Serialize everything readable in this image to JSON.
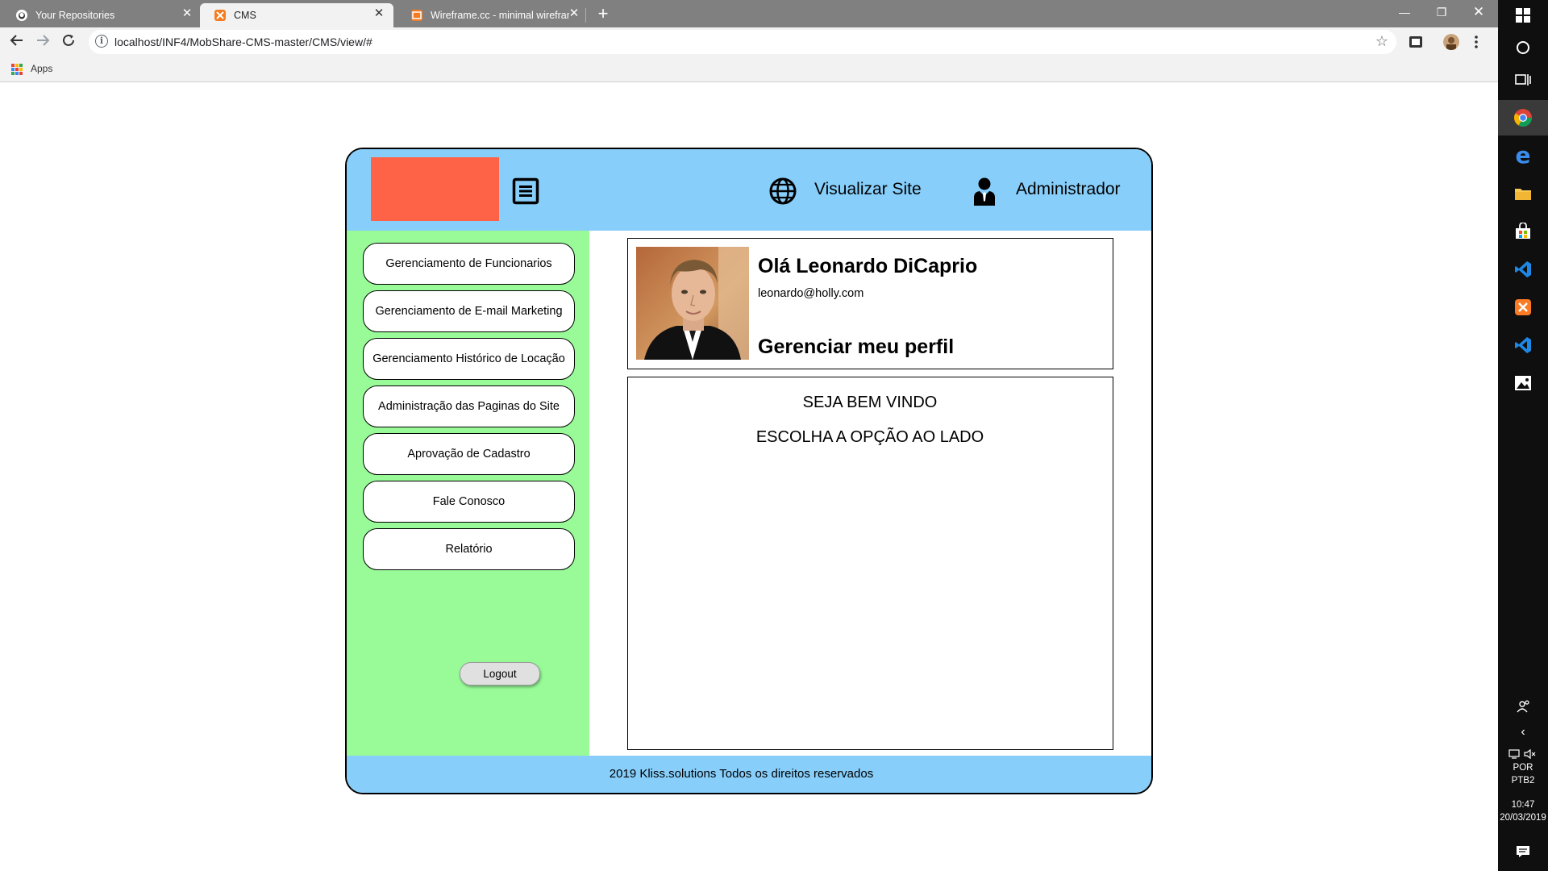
{
  "browser": {
    "tabs": [
      {
        "title": "Your Repositories",
        "active": false,
        "favicon": "github-icon"
      },
      {
        "title": "CMS",
        "active": true,
        "favicon": "xampp-icon"
      },
      {
        "title": "Wireframe.cc - minimal wirefram",
        "active": false,
        "favicon": "wireframe-icon"
      }
    ],
    "url": "localhost/INF4/MobShare-CMS-master/CMS/view/#",
    "bookmarks": {
      "apps_label": "Apps"
    }
  },
  "cms": {
    "colors": {
      "header": "#87cefa",
      "sidebar": "#98fb98",
      "logo": "#ff6347",
      "footer": "#87cefa"
    },
    "header": {
      "menu_icon": "list-icon",
      "view_site_icon": "globe-icon",
      "view_site_label": "Visualizar Site",
      "admin_icon": "user-icon",
      "admin_label": "Administrador"
    },
    "sidebar": {
      "items": [
        {
          "label": "Gerenciamento de Funcionarios"
        },
        {
          "label": "Gerenciamento de E-mail Marketing"
        },
        {
          "label": "Gerenciamento Histórico de Locação"
        },
        {
          "label": "Administração das Paginas do Site"
        },
        {
          "label": "Aprovação de Cadastro"
        },
        {
          "label": "Fale Conosco"
        },
        {
          "label": "Relatório"
        }
      ],
      "logout_label": "Logout"
    },
    "profile": {
      "greeting": "Olá Leonardo DiCaprio",
      "email": "leonardo@holly.com",
      "manage_label": "Gerenciar meu perfil"
    },
    "content": {
      "welcome_line1": "SEJA BEM VINDO",
      "welcome_line2": "ESCOLHA A OPÇÃO AO LADO"
    },
    "footer": {
      "text": "2019 Kliss.solutions Todos os direitos reservados"
    }
  },
  "taskbar": {
    "language_line1": "POR",
    "language_line2": "PTB2",
    "time": "10:47",
    "date": "20/03/2019"
  }
}
